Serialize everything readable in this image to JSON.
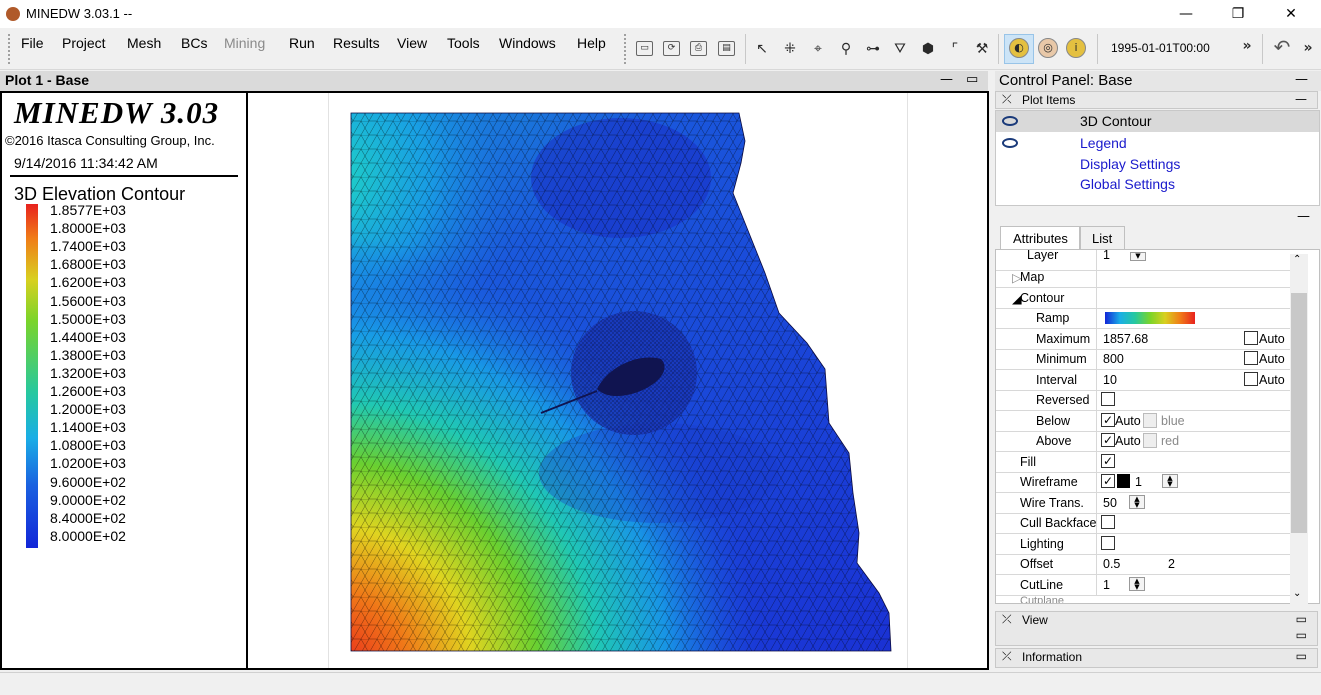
{
  "window": {
    "title": "MINEDW 3.03.1 --",
    "minimize": "—",
    "restore": "❐",
    "close": "✕"
  },
  "menu": {
    "file": "File",
    "project": "Project",
    "mesh": "Mesh",
    "bcs": "BCs",
    "mining": "Mining",
    "run": "Run",
    "results": "Results",
    "view": "View",
    "tools": "Tools",
    "windows": "Windows",
    "help": "Help"
  },
  "toolbar": {
    "datetime": "1995-01-01T00:00",
    "overflow1": "»",
    "overflow2": "»",
    "undo": "↶"
  },
  "plot": {
    "header": "Plot 1 - Base",
    "brand": "MINEDW 3.03",
    "copyright": "©2016 Itasca Consulting Group, Inc.",
    "date": "9/14/2016 11:34:42 AM",
    "contour_title": "3D Elevation Contour",
    "levels": [
      "1.8577E+03",
      "1.8000E+03",
      "1.7400E+03",
      "1.6800E+03",
      "1.6200E+03",
      "1.5600E+03",
      "1.5000E+03",
      "1.4400E+03",
      "1.3800E+03",
      "1.3200E+03",
      "1.2600E+03",
      "1.2000E+03",
      "1.1400E+03",
      "1.0800E+03",
      "1.0200E+03",
      "9.6000E+02",
      "9.0000E+02",
      "8.4000E+02",
      "8.0000E+02"
    ],
    "colors": {
      "max": "#e8221e",
      "mid": "#7ad42a",
      "min": "#1226d8"
    }
  },
  "control_panel": {
    "header": "Control Panel: Base",
    "plot_items_label": "Plot Items",
    "items": [
      "3D Contour",
      "Legend",
      "Display Settings",
      "Global Settings"
    ],
    "tabs": [
      "Attributes",
      "List"
    ],
    "attributes": {
      "layer": {
        "key": "Layer",
        "value": "1"
      },
      "map": "Map",
      "contour": "Contour",
      "ramp": "Ramp",
      "maximum": {
        "key": "Maximum",
        "value": "1857.68",
        "auto": "Auto"
      },
      "minimum": {
        "key": "Minimum",
        "value": "800",
        "auto": "Auto"
      },
      "interval": {
        "key": "Interval",
        "value": "10",
        "auto": "Auto"
      },
      "reversed": "Reversed",
      "below": {
        "key": "Below",
        "auto": "Auto",
        "color": "blue"
      },
      "above": {
        "key": "Above",
        "auto": "Auto",
        "color": "red"
      },
      "fill": "Fill",
      "wireframe": {
        "key": "Wireframe",
        "value": "1"
      },
      "wire_trans": {
        "key": "Wire Trans.",
        "value": "50"
      },
      "cull_backface": "Cull Backface",
      "lighting": "Lighting",
      "offset": {
        "key": "Offset",
        "value1": "0.5",
        "value2": "2"
      },
      "cutline": {
        "key": "CutLine",
        "value": "1"
      },
      "cutplane": "Cutplane"
    },
    "view_label": "View",
    "information_label": "Information"
  }
}
